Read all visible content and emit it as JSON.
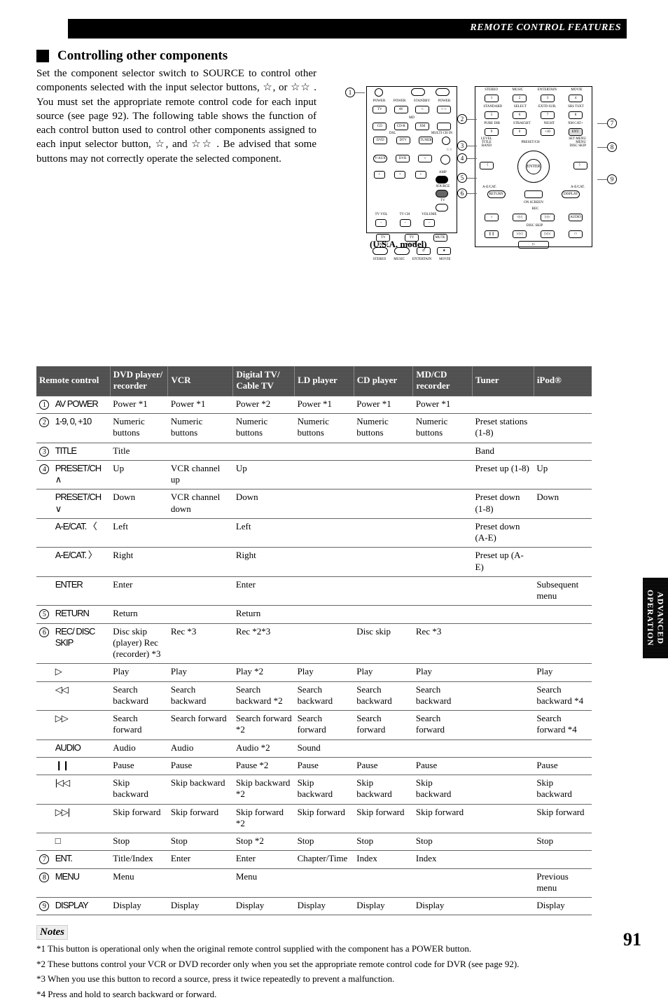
{
  "header_bar": "REMOTE CONTROL FEATURES",
  "section_title": "Controlling other components",
  "intro_html": "Set the component selector switch to SOURCE to control other components selected with the input selector buttons, ☆, or ☆☆ . You must set the appropriate remote control code for each input source (see page 92). The following table shows the function of each control button used to control other components assigned to each input selector button, ☆, and ☆☆ . Be advised that some buttons may not correctly operate the selected component.",
  "usa_model": "(U.S.A. model)",
  "callouts_left": [
    "1",
    "2"
  ],
  "callouts_right": [
    "7",
    "8",
    "9"
  ],
  "callouts_mid_right": [
    "3",
    "4",
    "5",
    "6"
  ],
  "columns": [
    "Remote control",
    "DVD player/ recorder",
    "VCR",
    "Digital TV/ Cable TV",
    "LD player",
    "CD player",
    "MD/CD recorder",
    "Tuner",
    "iPod®"
  ],
  "rows": [
    {
      "idx": "1",
      "rc": "AV POWER",
      "cells": [
        "Power *1",
        "Power *1",
        "Power *2",
        "Power *1",
        "Power *1",
        "Power *1",
        "",
        ""
      ]
    },
    {
      "idx": "2",
      "rc": "1-9, 0, +10",
      "cells": [
        "Numeric buttons",
        "Numeric buttons",
        "Numeric buttons",
        "Numeric buttons",
        "Numeric buttons",
        "Numeric buttons",
        "Preset stations (1-8)",
        ""
      ]
    },
    {
      "idx": "3",
      "rc": "TITLE",
      "cells": [
        "Title",
        "",
        "",
        "",
        "",
        "",
        "Band",
        ""
      ]
    },
    {
      "idx": "4",
      "rc": "PRESET/CH ∧",
      "cells": [
        "Up",
        "VCR channel up",
        "Up",
        "",
        "",
        "",
        "Preset up (1-8)",
        "Up"
      ]
    },
    {
      "idx": "",
      "rc": "PRESET/CH ∨",
      "cells": [
        "Down",
        "VCR channel down",
        "Down",
        "",
        "",
        "",
        "Preset down (1-8)",
        "Down"
      ]
    },
    {
      "idx": "",
      "rc": "A-E/CAT. 〈",
      "cells": [
        "Left",
        "",
        "Left",
        "",
        "",
        "",
        "Preset down (A-E)",
        ""
      ]
    },
    {
      "idx": "",
      "rc": "A-E/CAT. 〉",
      "cells": [
        "Right",
        "",
        "Right",
        "",
        "",
        "",
        "Preset up (A-E)",
        ""
      ]
    },
    {
      "idx": "",
      "rc": "ENTER",
      "cells": [
        "Enter",
        "",
        "Enter",
        "",
        "",
        "",
        "",
        "Subsequent menu"
      ]
    },
    {
      "idx": "5",
      "rc": "RETURN",
      "cells": [
        "Return",
        "",
        "Return",
        "",
        "",
        "",
        "",
        ""
      ]
    },
    {
      "idx": "6",
      "rc": "REC/ DISC SKIP",
      "cells": [
        "Disc skip (player) Rec (recorder) *3",
        "Rec *3",
        "Rec *2*3",
        "",
        "Disc skip",
        "Rec *3",
        "",
        ""
      ]
    },
    {
      "idx": "",
      "rc": "▷",
      "cells": [
        "Play",
        "Play",
        "Play *2",
        "Play",
        "Play",
        "Play",
        "",
        "Play"
      ]
    },
    {
      "idx": "",
      "rc": "◁◁",
      "cells": [
        "Search backward",
        "Search backward",
        "Search backward *2",
        "Search backward",
        "Search backward",
        "Search backward",
        "",
        "Search backward *4"
      ]
    },
    {
      "idx": "",
      "rc": "▷▷",
      "cells": [
        "Search forward",
        "Search forward",
        "Search forward *2",
        "Search forward",
        "Search forward",
        "Search forward",
        "",
        "Search forward *4"
      ]
    },
    {
      "idx": "",
      "rc": "AUDIO",
      "cells": [
        "Audio",
        "Audio",
        "Audio *2",
        "Sound",
        "",
        "",
        "",
        ""
      ]
    },
    {
      "idx": "",
      "rc": "❙❙",
      "cells": [
        "Pause",
        "Pause",
        "Pause *2",
        "Pause",
        "Pause",
        "Pause",
        "",
        "Pause"
      ]
    },
    {
      "idx": "",
      "rc": "|◁◁",
      "cells": [
        "Skip backward",
        "Skip backward",
        "Skip backward *2",
        "Skip backward",
        "Skip backward",
        "Skip backward",
        "",
        "Skip backward"
      ]
    },
    {
      "idx": "",
      "rc": "▷▷|",
      "cells": [
        "Skip forward",
        "Skip forward",
        "Skip forward *2",
        "Skip forward",
        "Skip forward",
        "Skip forward",
        "",
        "Skip forward"
      ]
    },
    {
      "idx": "",
      "rc": "□",
      "cells": [
        "Stop",
        "Stop",
        "Stop *2",
        "Stop",
        "Stop",
        "Stop",
        "",
        "Stop"
      ]
    },
    {
      "idx": "7",
      "rc": "ENT.",
      "cells": [
        "Title/Index",
        "Enter",
        "Enter",
        "Chapter/Time",
        "Index",
        "Index",
        "",
        ""
      ]
    },
    {
      "idx": "8",
      "rc": "MENU",
      "cells": [
        "Menu",
        "",
        "Menu",
        "",
        "",
        "",
        "",
        "Previous menu"
      ]
    },
    {
      "idx": "9",
      "rc": "DISPLAY",
      "cells": [
        "Display",
        "Display",
        "Display",
        "Display",
        "Display",
        "Display",
        "",
        "Display"
      ]
    }
  ],
  "notes_label": "Notes",
  "notes": [
    "*1 This button is operational only when the original remote control supplied with the component has a POWER button.",
    "*2 These buttons control your VCR or DVD recorder only when you set the appropriate remote control code for DVR (see page 92).",
    "*3 When you use this button to record a source, press it twice repeatedly to prevent a malfunction.",
    "*4 Press and hold to search backward or forward."
  ],
  "sidetab": "ADVANCED OPERATION",
  "page_number": "91",
  "remote_labels_row1": [
    "POWER",
    "AV",
    "☆",
    "☆☆"
  ],
  "remote_labels_row2": [
    "TV",
    "",
    "STANDBY",
    "POWER"
  ],
  "remote_labels_row3": [
    "CD",
    "CD-R",
    "XM",
    "–"
  ],
  "remote_labels_row4": [
    "DVD",
    "DTV",
    "TUNER",
    "○"
  ],
  "remote_labels_row5": [
    "V-AUX",
    "DVR",
    "☆",
    "○"
  ],
  "remote_labels_vol": [
    "+",
    "+",
    "+"
  ],
  "remote_labels_vol2": [
    "TV VOL",
    "TV CH",
    "VOLUME"
  ],
  "remote_labels_bottom": [
    "TV INPUT",
    "TV MUTE",
    "MUTE"
  ],
  "remote2_row1": [
    "STEREO",
    "MUSIC",
    "ENTERTAIN",
    "MOVIE"
  ],
  "remote2_row2": [
    "STANDARD",
    "SELECT",
    "EXTD SUR.",
    "SRS TSXT"
  ],
  "remote2_row3": [
    "PURE DIRECT",
    "STRAIGHT",
    "NIGHT",
    "XM CAT +"
  ],
  "remote2_row4": [
    "LEVEL",
    "TITLE",
    "BAND",
    "PRESET/CH",
    "SET MENU",
    "MENU",
    "DISC SKIP"
  ],
  "remote2_nav": [
    "∧",
    "〈",
    "ENTER",
    "〉",
    "∨"
  ],
  "remote2_row5": [
    "RETURN",
    "ON SCREEN",
    "DISPLAY"
  ],
  "remote2_row6": [
    "REC",
    "AUDIO",
    "ENT."
  ],
  "remote2_row7": [
    "□",
    "|◁◁",
    "▷▷|",
    "□"
  ],
  "remote2_row8": [
    "▷"
  ]
}
